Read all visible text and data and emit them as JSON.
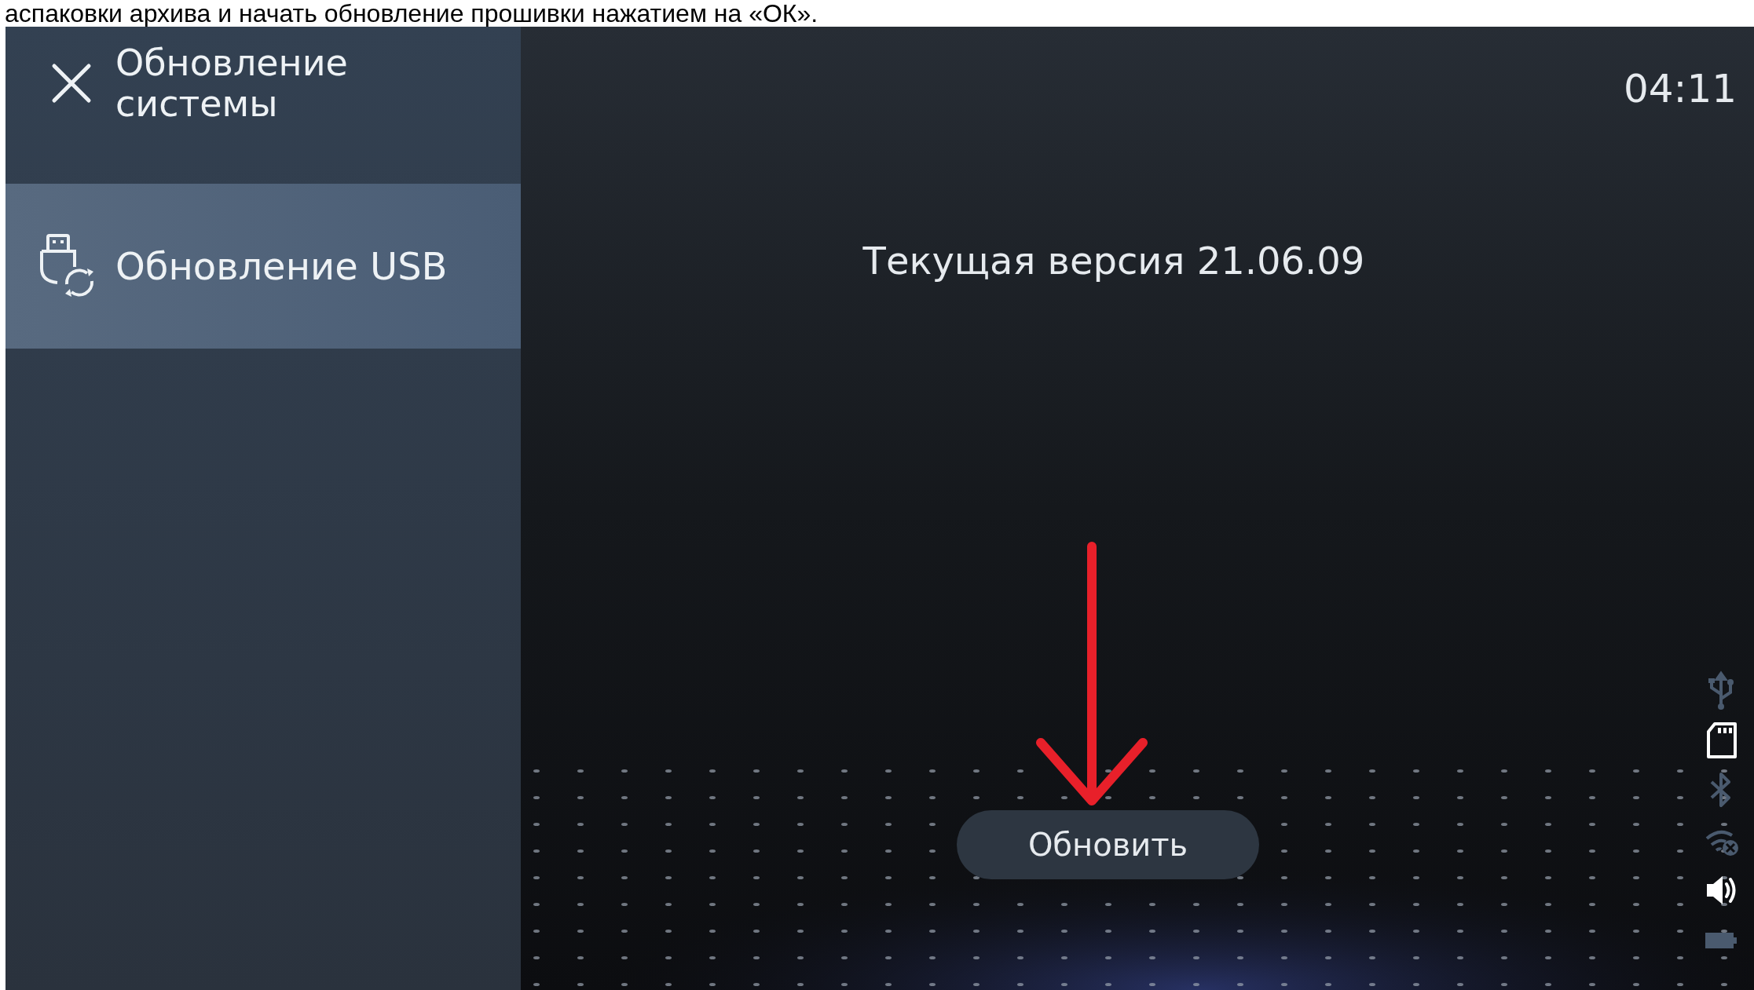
{
  "page_caption": "аспаковки архива и начать обновление прошивки нажатием на «ОК».",
  "sidebar": {
    "title": "Обновление системы",
    "items": [
      {
        "label": "Обновление USB",
        "selected": true
      }
    ]
  },
  "clock": "04:11",
  "current_version": "Текущая версия 21.06.09",
  "update_button": "Обновить",
  "status_icons": [
    {
      "kind": "usb",
      "active": false
    },
    {
      "kind": "sdcard",
      "active": true
    },
    {
      "kind": "bluetooth",
      "active": false
    },
    {
      "kind": "wifi_off",
      "active": false
    },
    {
      "kind": "volume",
      "active": true
    },
    {
      "kind": "battery",
      "active": false
    }
  ]
}
